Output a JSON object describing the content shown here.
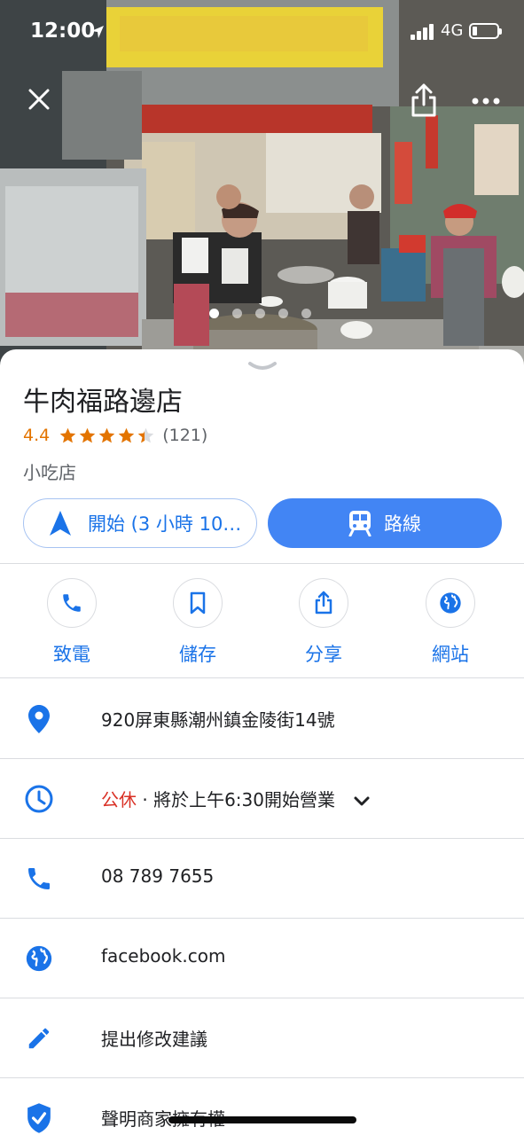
{
  "status": {
    "time": "12:00",
    "network": "4G"
  },
  "place": {
    "name": "牛肉福路邊店",
    "rating": "4.4",
    "rating_value": 4.4,
    "review_count": "(121)",
    "category": "小吃店"
  },
  "buttons": {
    "start": "開始 (3 小時 10…",
    "route": "路線"
  },
  "actions": [
    {
      "label": "致電",
      "icon": "phone-icon"
    },
    {
      "label": "儲存",
      "icon": "bookmark-icon"
    },
    {
      "label": "分享",
      "icon": "share-icon"
    },
    {
      "label": "網站",
      "icon": "globe-icon"
    }
  ],
  "details": {
    "address": "920屏東縣潮州鎮金陵街14號",
    "hours_status": "公休",
    "hours_next": "· 將於上午6:30開始營業",
    "phone": "08 789 7655",
    "website": "facebook.com",
    "suggest_edit": "提出修改建議",
    "claim_business": "聲明商家擁有權"
  },
  "colors": {
    "accent": "#1a73e8",
    "primary_button": "#4285f4",
    "rating": "#e37400",
    "closed": "#d93025"
  }
}
